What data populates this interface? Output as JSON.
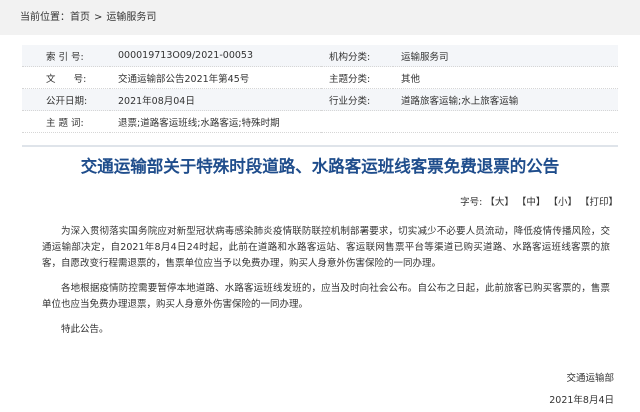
{
  "breadcrumb": {
    "label": "当前位置：",
    "home": "首页",
    "separator": ">",
    "current": "运输服务司"
  },
  "meta": {
    "index_label": "索 引 号:",
    "index_value": "000019713O09/2021-00053",
    "org_label": "机构分类:",
    "org_value": "运输服务司",
    "docno_label": "文      号:",
    "docno_value": "交通运输部公告2021年第45号",
    "subject_label": "主题分类:",
    "subject_value": "其他",
    "date_label": "公开日期:",
    "date_value": "2021年08月04日",
    "industry_label": "行业分类:",
    "industry_value": "道路旅客运输;水上旅客运输",
    "keywords_label": "主 题 词:",
    "keywords_value": "退票;道路客运班线;水路客运;特殊时期"
  },
  "title": "交通运输部关于特殊时段道路、水路客运班线客票免费退票的公告",
  "fontsize": {
    "label": "字号:",
    "large": "【大】",
    "medium": "【中】",
    "small": "【小】",
    "print": "【打印】"
  },
  "content": {
    "p1": "为深入贯彻落实国务院应对新型冠状病毒感染肺炎疫情联防联控机制部署要求，切实减少不必要人员流动，降低疫情传播风险，交通运输部决定，自2021年8月4日24时起，此前在道路和水路客运站、客运联网售票平台等渠道已购买道路、水路客运班线客票的旅客，自愿改变行程需退票的，售票单位应当予以免费办理，购买人身意外伤害保险的一同办理。",
    "p2": "各地根据疫情防控需要暂停本地道路、水路客运班线发班的，应当及时向社会公布。自公布之日起，此前旅客已购买客票的，售票单位也应当免费办理退票，购买人身意外伤害保险的一同办理。",
    "p3": "特此公告。"
  },
  "sign": {
    "org": "交通运输部",
    "date": "2021年8月4日"
  }
}
